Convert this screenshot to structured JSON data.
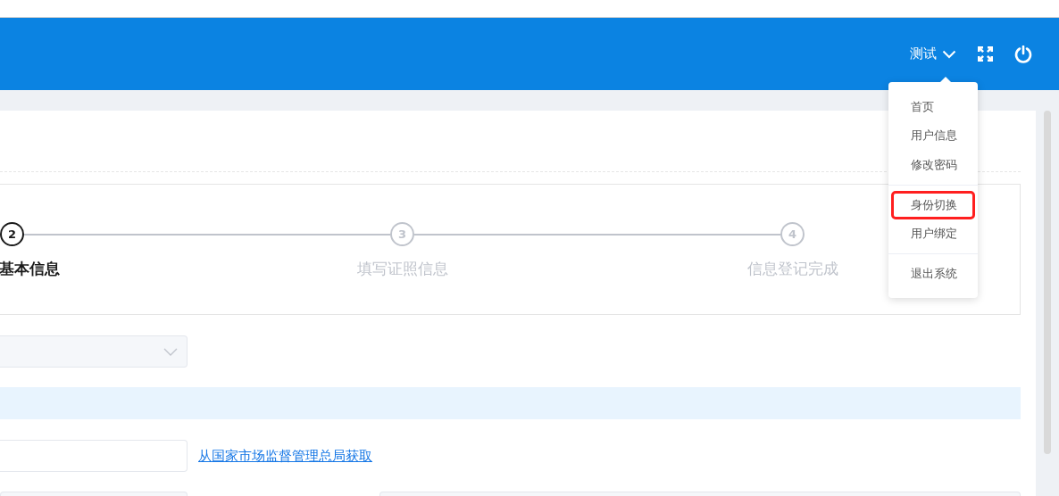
{
  "header": {
    "user": "测试"
  },
  "user_menu": {
    "groups": [
      {
        "items": [
          {
            "label": "首页",
            "highlighted": false
          },
          {
            "label": "用户信息",
            "highlighted": false
          },
          {
            "label": "修改密码",
            "highlighted": false
          }
        ]
      },
      {
        "items": [
          {
            "label": "身份切换",
            "highlighted": true
          },
          {
            "label": "用户绑定",
            "highlighted": false
          }
        ]
      },
      {
        "items": [
          {
            "label": "退出系统",
            "highlighted": false
          }
        ]
      }
    ]
  },
  "steps": [
    {
      "number": "2",
      "label": "基本信息",
      "selected": true
    },
    {
      "number": "3",
      "label": "填写证照信息",
      "selected": false
    },
    {
      "number": "4",
      "label": "信息登记完成",
      "selected": false
    }
  ],
  "link": "从国家市场监督管理总局获取"
}
